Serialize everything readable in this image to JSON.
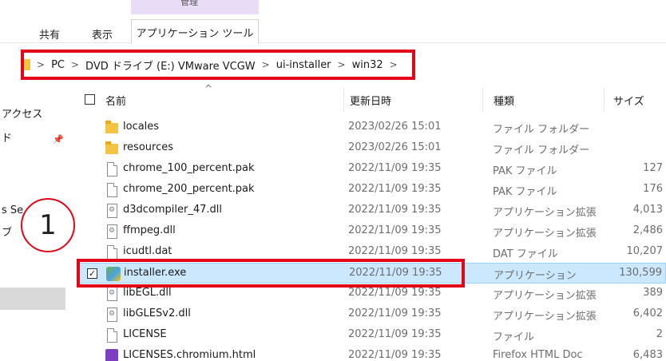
{
  "ribbon": {
    "context_label": "管理",
    "tabs": [
      "共有",
      "表示",
      "アプリケーション ツール"
    ]
  },
  "breadcrumb": {
    "items": [
      "PC",
      "DVD ドライブ (E:) VMware VCGW",
      "ui-installer",
      "win32"
    ],
    "separator": ">"
  },
  "nav": {
    "items": [
      "アクセス",
      "ド",
      "s Se",
      "ブ"
    ]
  },
  "columns": {
    "name": "名前",
    "date": "更新日時",
    "type": "種類",
    "size": "サイズ"
  },
  "files": [
    {
      "name": "locales",
      "date": "2023/02/26 15:01",
      "type": "ファイル フォルダー",
      "size": "",
      "icon": "folder-icon"
    },
    {
      "name": "resources",
      "date": "2023/02/26 15:01",
      "type": "ファイル フォルダー",
      "size": "",
      "icon": "folder-icon"
    },
    {
      "name": "chrome_100_percent.pak",
      "date": "2022/11/09 19:35",
      "type": "PAK ファイル",
      "size": "127",
      "icon": "file-icon"
    },
    {
      "name": "chrome_200_percent.pak",
      "date": "2022/11/09 19:35",
      "type": "PAK ファイル",
      "size": "176",
      "icon": "file-icon"
    },
    {
      "name": "d3dcompiler_47.dll",
      "date": "2022/11/09 19:35",
      "type": "アプリケーション拡張",
      "size": "4,013",
      "icon": "dll-icon"
    },
    {
      "name": "ffmpeg.dll",
      "date": "2022/11/09 19:35",
      "type": "アプリケーション拡張",
      "size": "2,486",
      "icon": "dll-icon"
    },
    {
      "name": "icudtl.dat",
      "date": "2022/11/09 19:35",
      "type": "DAT ファイル",
      "size": "10,207",
      "icon": "file-icon"
    },
    {
      "name": "installer.exe",
      "date": "2022/11/09 19:35",
      "type": "アプリケーション",
      "size": "130,599",
      "icon": "exe-icon"
    },
    {
      "name": "libEGL.dll",
      "date": "2022/11/09 19:35",
      "type": "アプリケーション拡張",
      "size": "389",
      "icon": "dll-icon"
    },
    {
      "name": "libGLESv2.dll",
      "date": "2022/11/09 19:35",
      "type": "アプリケーション拡張",
      "size": "6,402",
      "icon": "dll-icon"
    },
    {
      "name": "LICENSE",
      "date": "2022/11/09 19:35",
      "type": "ファイル",
      "size": "2",
      "icon": "file-icon"
    },
    {
      "name": "LICENSES.chromium.html",
      "date": "2022/11/09 19:35",
      "type": "Firefox HTML Doc",
      "size": "6,483",
      "icon": "html-icon"
    }
  ],
  "annotation": {
    "marker": "1"
  },
  "colors": {
    "highlight_red": "#e1061a",
    "selected_row": "#cce8ff",
    "context_tab": "#e8dcf7"
  }
}
